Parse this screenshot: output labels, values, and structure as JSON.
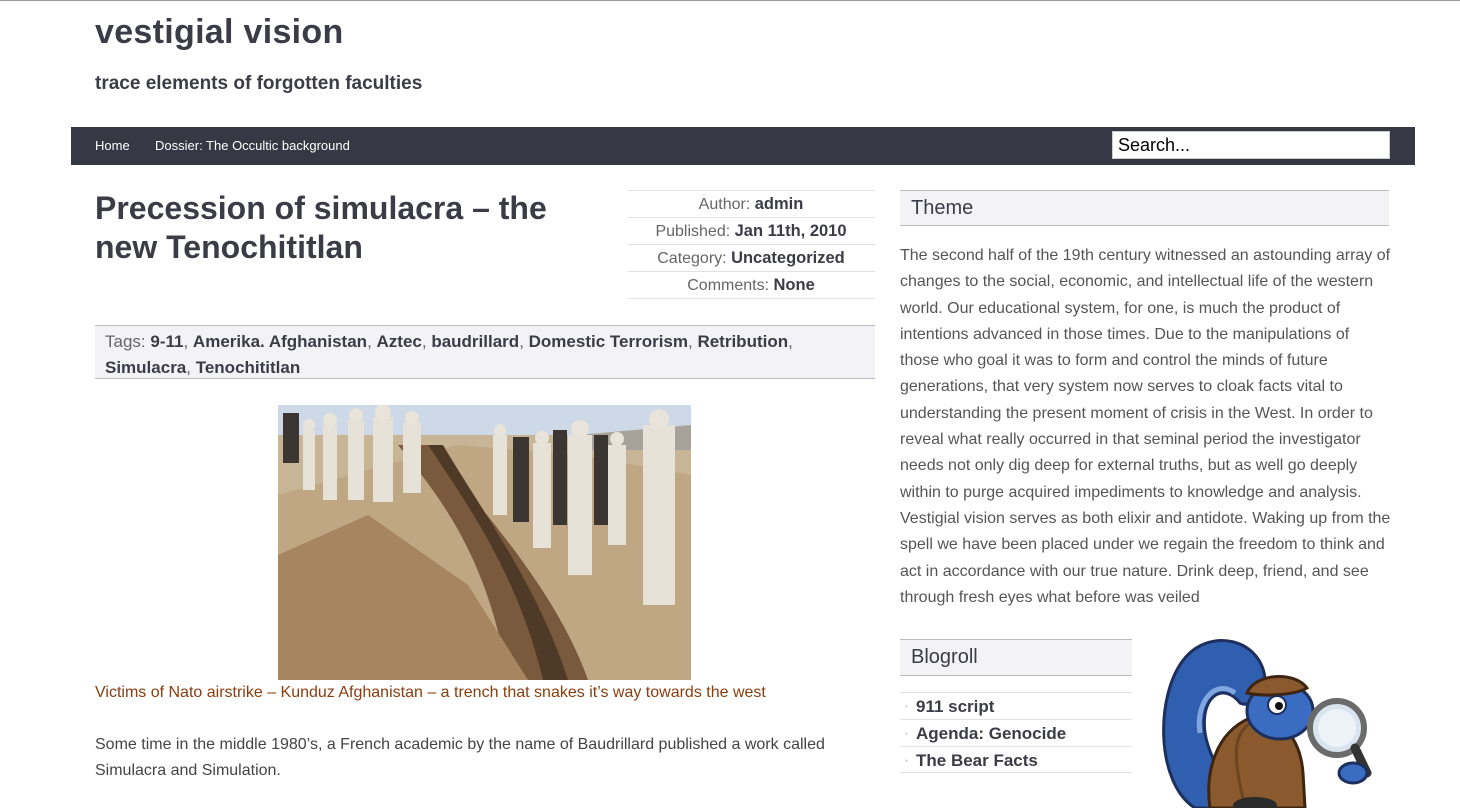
{
  "site": {
    "title": "vestigial vision",
    "tagline": "trace elements of forgotten faculties"
  },
  "nav": {
    "items": [
      {
        "label": "Home"
      },
      {
        "label": "Dossier: The Occultic background"
      }
    ],
    "search_value": "Search..."
  },
  "post": {
    "title": "Precession of simulacra – the new Tenochititlan",
    "meta": {
      "author_label": "Author:",
      "author": "admin",
      "published_label": "Published:",
      "published": "Jan 11th, 2010",
      "category_label": "Category:",
      "category": "Uncategorized",
      "comments_label": "Comments:",
      "comments": "None"
    },
    "tags_label": "Tags:",
    "tags": [
      "9-11",
      "Amerika. Afghanistan",
      "Aztec",
      "baudrillard",
      "Domestic Terrorism",
      "Retribution",
      "Simulacra",
      "Tenochititlan"
    ],
    "caption": "Victims of Nato airstrike – Kunduz Afghanistan – a trench that snakes it’s way towards the west",
    "body": "Some time in the middle 1980’s, a French academic by the name of Baudrillard published a work called Simulacra and Simulation."
  },
  "sidebar": {
    "theme_heading": "Theme",
    "theme_text": "The second half of the 19th century witnessed an astounding array of changes to the social, economic, and intellectual life of the western world. Our educational system, for one, is much the product of intentions advanced in those times. Due to the manipulations of those who goal it was to form and control the minds of future generations, that very system now serves to cloak facts vital to understanding the present moment of crisis in the West. In order to reveal what really occurred in that seminal period the investigator needs not only dig deep for external truths, but as well go deeply within to purge acquired impediments to knowledge and analysis. Vestigial vision serves as both elixir and antidote. Waking up from the spell we have been placed under we regain the freedom to think and act in accordance with our true nature. Drink deep, friend, and see through fresh eyes what before was veiled",
    "blogroll_heading": "Blogroll",
    "blogroll": [
      {
        "label": "911 script"
      },
      {
        "label": "Agenda: Genocide"
      },
      {
        "label": "The Bear Facts"
      }
    ]
  },
  "colors": {
    "nav_bg": "#363844",
    "title_text": "#3c3c46",
    "caption": "#8a3d0e",
    "heading_bg": "#f3f3f7"
  }
}
